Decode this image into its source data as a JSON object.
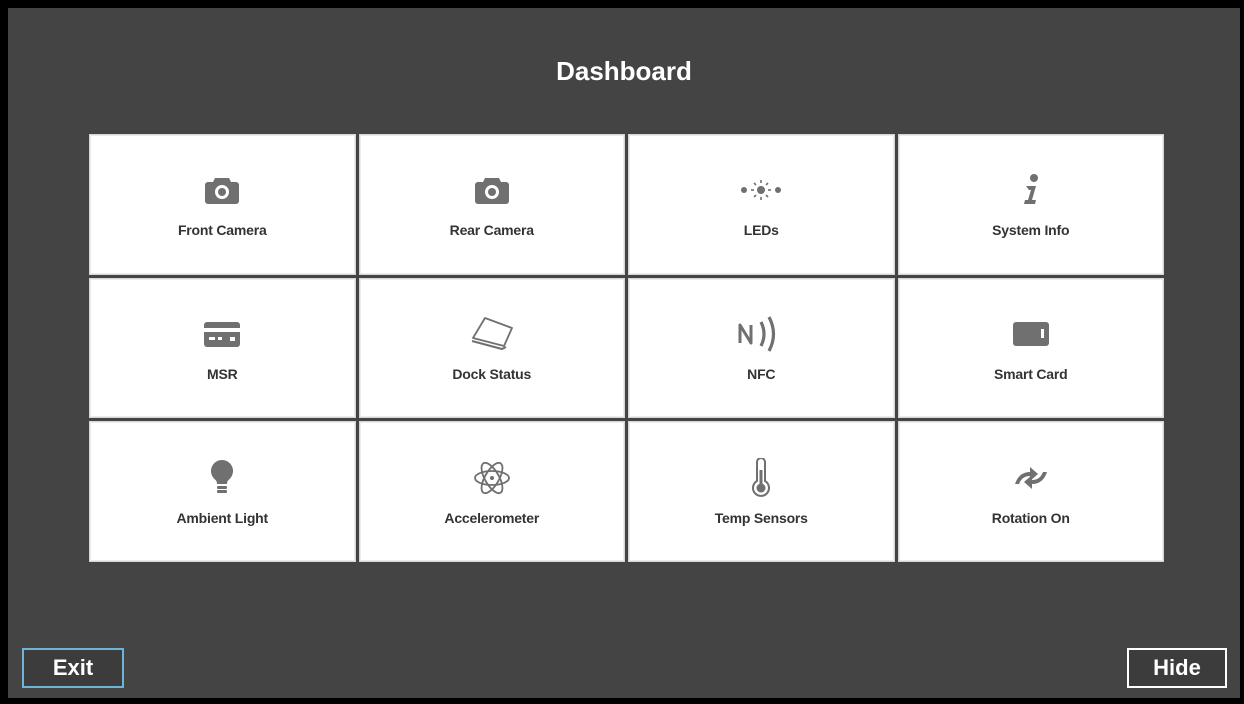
{
  "page": {
    "title": "Dashboard"
  },
  "tiles": [
    {
      "label": "Front Camera",
      "icon": "camera-icon"
    },
    {
      "label": "Rear Camera",
      "icon": "camera-icon"
    },
    {
      "label": "LEDs",
      "icon": "led-icon"
    },
    {
      "label": "System Info",
      "icon": "info-icon"
    },
    {
      "label": "MSR",
      "icon": "card-reader-icon"
    },
    {
      "label": "Dock Status",
      "icon": "dock-icon"
    },
    {
      "label": "NFC",
      "icon": "nfc-icon"
    },
    {
      "label": "Smart Card",
      "icon": "smart-card-icon"
    },
    {
      "label": "Ambient Light",
      "icon": "lightbulb-icon"
    },
    {
      "label": "Accelerometer",
      "icon": "atom-icon"
    },
    {
      "label": "Temp Sensors",
      "icon": "thermometer-icon"
    },
    {
      "label": "Rotation On",
      "icon": "rotation-icon"
    }
  ],
  "buttons": {
    "exit_label": "Exit",
    "hide_label": "Hide"
  },
  "colors": {
    "background": "#444444",
    "tile": "#ffffff",
    "icon": "#707070",
    "exit_border": "#6fb3d6"
  }
}
